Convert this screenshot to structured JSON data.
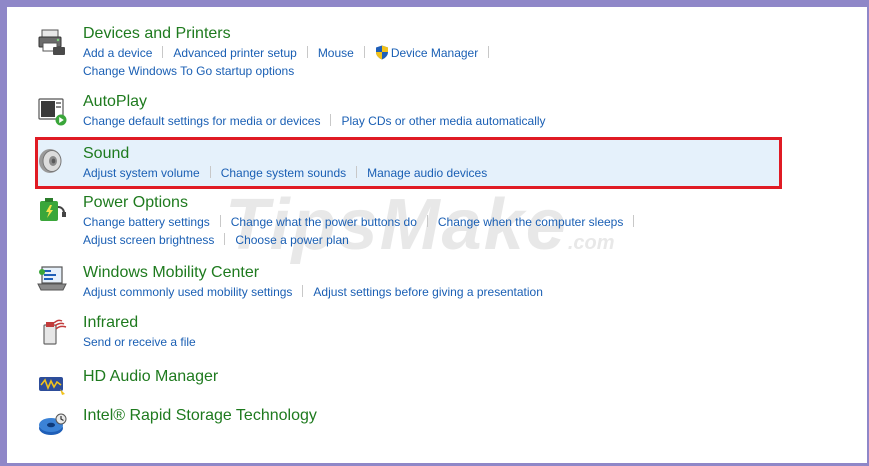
{
  "watermark": {
    "main": "TipsMake",
    "suffix": ".com"
  },
  "groups": {
    "devices": {
      "title": "Devices and Printers",
      "icon": "printer-icon",
      "links": [
        "Add a device",
        "Advanced printer setup",
        "Mouse",
        "Device Manager",
        "Change Windows To Go startup options"
      ]
    },
    "autoplay": {
      "title": "AutoPlay",
      "icon": "autoplay-icon",
      "links": [
        "Change default settings for media or devices",
        "Play CDs or other media automatically"
      ]
    },
    "sound": {
      "title": "Sound",
      "icon": "speaker-icon",
      "highlighted": true,
      "links": [
        "Adjust system volume",
        "Change system sounds",
        "Manage audio devices"
      ]
    },
    "power": {
      "title": "Power Options",
      "icon": "power-options-icon",
      "links": [
        "Change battery settings",
        "Change what the power buttons do",
        "Change when the computer sleeps",
        "Adjust screen brightness",
        "Choose a power plan"
      ]
    },
    "mobility": {
      "title": "Windows Mobility Center",
      "icon": "mobility-center-icon",
      "links": [
        "Adjust commonly used mobility settings",
        "Adjust settings before giving a presentation"
      ]
    },
    "infrared": {
      "title": "Infrared",
      "icon": "infrared-icon",
      "links": [
        "Send or receive a file"
      ]
    },
    "hdaudio": {
      "title": "HD Audio Manager",
      "icon": "hd-audio-icon",
      "links": []
    },
    "rst": {
      "title": "Intel® Rapid Storage Technology",
      "icon": "rapid-storage-icon",
      "links": []
    }
  },
  "colors": {
    "frame": "#8f87c8",
    "title": "#1e7a1e",
    "link": "#1a5fb4",
    "highlight_border": "#e01b24",
    "highlight_bg": "#e5f1fb"
  }
}
